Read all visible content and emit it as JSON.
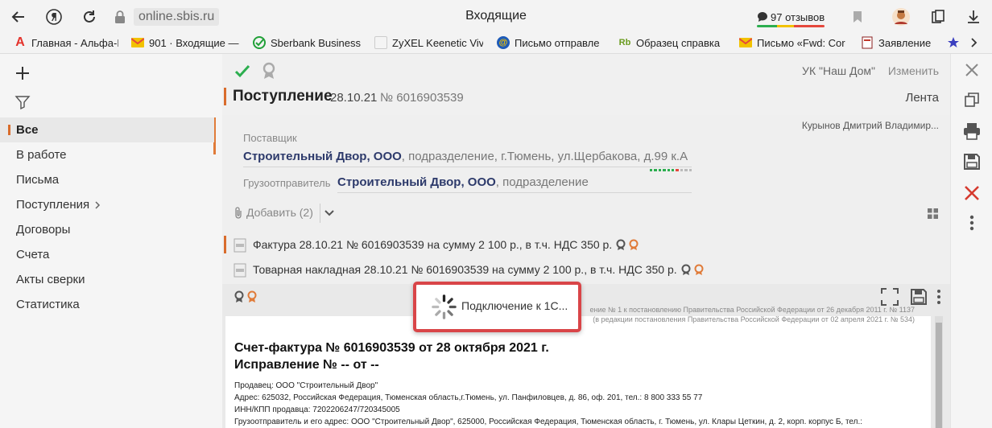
{
  "browser": {
    "url": "online.sbis.ru",
    "page_title": "Входящие",
    "reviews_label": "97 отзывов",
    "icons": [
      "back-icon",
      "yandex-icon",
      "reload-icon",
      "lock-icon",
      "bookmark-icon",
      "profile-icon",
      "collections-icon",
      "download-icon"
    ]
  },
  "bookmarks": [
    {
      "label": "Главная - Альфа-Б",
      "icon": "alfa-icon"
    },
    {
      "label": "901 · Входящие —",
      "icon": "mail-icon"
    },
    {
      "label": "Sberbank Business",
      "icon": "sber-icon"
    },
    {
      "label": "ZyXEL Keenetic Viv",
      "icon": "zyxel-icon"
    },
    {
      "label": "Письмо отправле",
      "icon": "mailru-icon"
    },
    {
      "label": "Образец справка",
      "icon": "rb-icon"
    },
    {
      "label": "Письмо «Fwd: Cor",
      "icon": "mail-icon"
    },
    {
      "label": "Заявление",
      "icon": "doc-icon"
    }
  ],
  "sidebar": {
    "items": [
      {
        "label": "Все"
      },
      {
        "label": "В работе"
      },
      {
        "label": "Письма"
      },
      {
        "label": "Поступления"
      },
      {
        "label": "Договоры"
      },
      {
        "label": "Счета"
      },
      {
        "label": "Акты сверки"
      },
      {
        "label": "Статистика"
      }
    ]
  },
  "document": {
    "organization": "УК \"Наш Дом\"",
    "change_label": "Изменить",
    "type": "Поступление",
    "date": "28.10.21",
    "number": "№ 6016903539",
    "feed_label": "Лента",
    "signed_by": "Курынов Дмитрий Владимир...",
    "supplier_label": "Поставщик",
    "supplier_name": "Строительный Двор, ООО",
    "supplier_details": ", подразделение, г.Тюмень, ул.Щербакова, д.99 к.А",
    "shipper_label": "Грузоотправитель",
    "shipper_name": "Строительный Двор, ООО",
    "shipper_details": ", подразделение",
    "add_label": "Добавить (2)",
    "attachments": [
      {
        "text": "Фактура 28.10.21 № 6016903539 на сумму 2 100 р., в т.ч. НДС 350 р."
      },
      {
        "text": "Товарная накладная 28.10.21 № 6016903539 на сумму 2 100 р., в т.ч. НДС 350 р."
      }
    ]
  },
  "viewer": {
    "legal_line1": "ение № 1 к постановлению Правительства Российской Федерации от 26 декабря 2011 г. № 1137",
    "legal_line2": "(в редакции постановления Правительства Российской Федерации от 02 апреля 2021 г. № 534)",
    "title_line1": "Счет-фактура № 6016903539 от 28 октября 2021 г.",
    "title_line2": "Исправление № -- от --",
    "seller": "Продавец:  ООО \"Строительный Двор\"",
    "address": "Адрес:  625032, Российская Федерация, Тюменская область,г.Тюмень, ул. Панфиловцев, д. 86, оф. 201, тел.: 8 800 333 55 77",
    "inn": "ИНН/КПП продавца:  7202206247/720345005",
    "shipper": "Грузоотправитель и его адрес:  ООО \"Строительный Двор\", 625000, Российская Федерация, Тюменская область, г. Тюмень, ул. Клары Цеткин, д. 2, корп. корпус Б, тел.:"
  },
  "loader": {
    "message": "Подключение к 1С..."
  },
  "colors": {
    "accent": "#d96c2c",
    "dialog_border": "#d94548",
    "check_green": "#2cae4f",
    "company_blue": "#2d3a6b"
  }
}
